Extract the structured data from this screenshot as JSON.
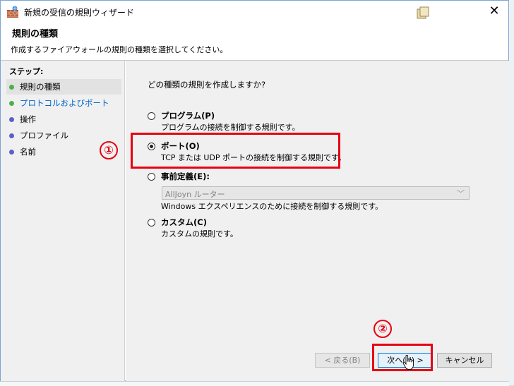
{
  "window": {
    "title": "新規の受信の規則ウィザード",
    "close_glyph": "✕"
  },
  "header": {
    "title": "規則の種類",
    "subtitle": "作成するファイアウォールの規則の種類を選択してください。"
  },
  "sidebar": {
    "steps_label": "ステップ:",
    "steps": [
      {
        "label": "規則の種類",
        "state": "current",
        "dot_color": "#4caf50"
      },
      {
        "label": "プロトコルおよびポート",
        "state": "link",
        "dot_color": "#4caf50"
      },
      {
        "label": "操作",
        "state": "pending",
        "dot_color": "#5b5fc7"
      },
      {
        "label": "プロファイル",
        "state": "pending",
        "dot_color": "#5b5fc7"
      },
      {
        "label": "名前",
        "state": "pending",
        "dot_color": "#5b5fc7"
      }
    ]
  },
  "main": {
    "question": "どの種類の規則を作成しますか?",
    "options": [
      {
        "label": "プログラム(P)",
        "desc": "プログラムの接続を制御する規則です。",
        "checked": false
      },
      {
        "label": "ポート(O)",
        "desc": "TCP または UDP ポートの接続を制御する規則です。",
        "checked": true
      },
      {
        "label": "事前定義(E):",
        "desc": "",
        "checked": false
      },
      {
        "label": "カスタム(C)",
        "desc": "カスタムの規則です。",
        "checked": false
      }
    ],
    "predefined_dropdown": {
      "value": "AllJoyn ルーター",
      "desc": "Windows エクスペリエンスのために接続を制御する規則です。",
      "disabled": true
    }
  },
  "buttons": {
    "back": "< 戻る(B)",
    "next": "次へ(N) >",
    "cancel": "キャンセル"
  },
  "callouts": {
    "one": "①",
    "two": "②"
  },
  "colors": {
    "highlight": "#e60012",
    "link": "#0066cc",
    "default_button_border": "#0078d7"
  }
}
